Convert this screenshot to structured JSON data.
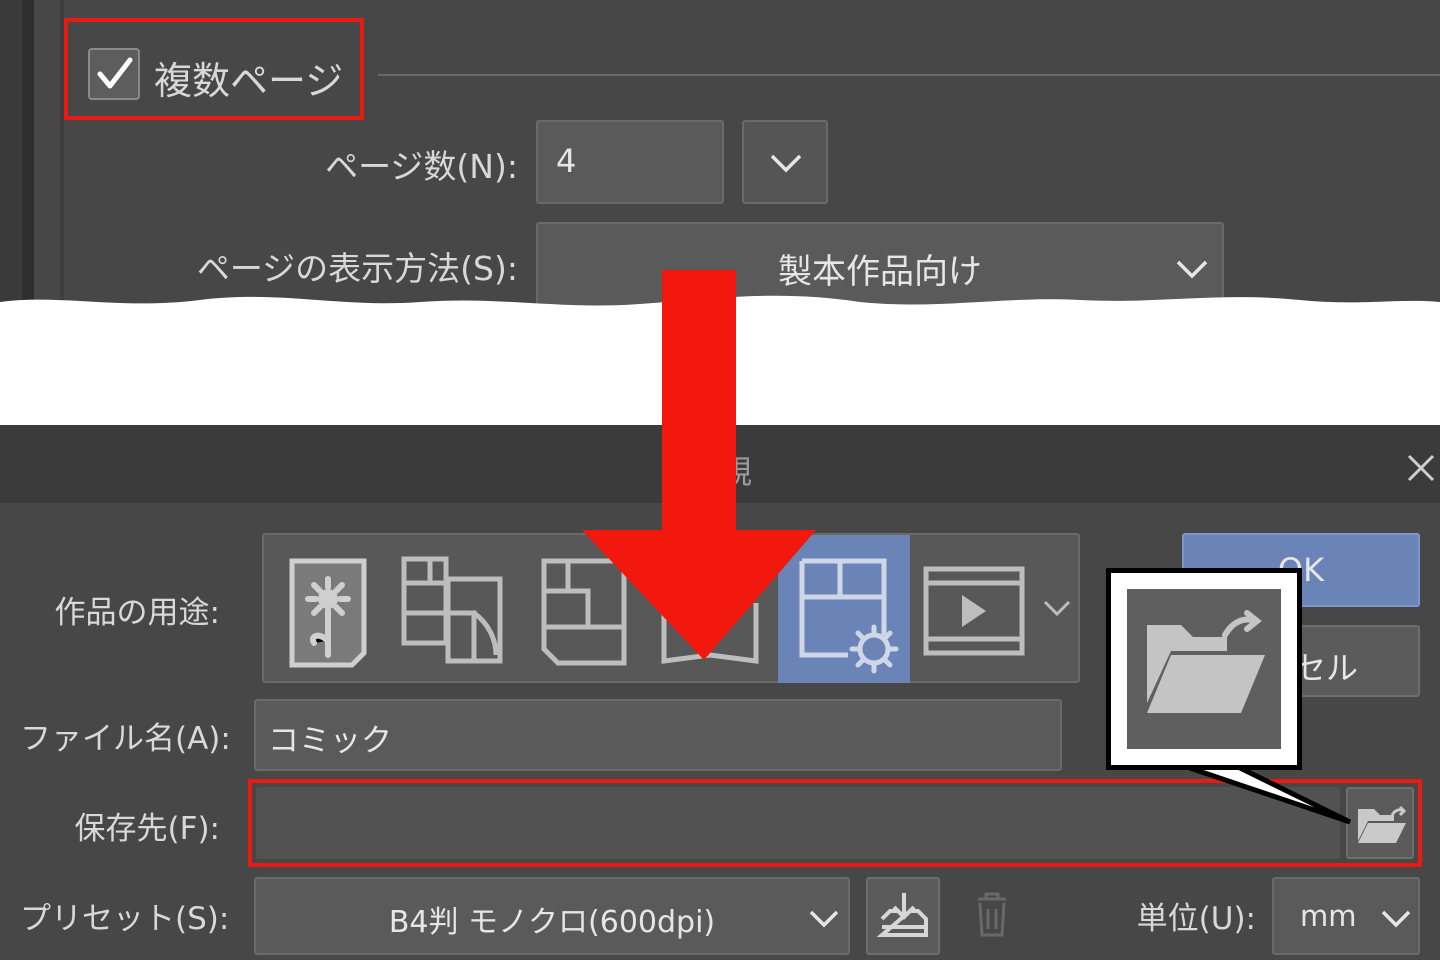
{
  "top": {
    "multi_page_label": "複数ページ",
    "multi_page_checked": true,
    "page_count_label": "ページ数(N):",
    "page_count_value": "4",
    "page_display_label": "ページの表示方法(S):",
    "page_display_value": "製本作品向け"
  },
  "dialog": {
    "title_fragment": "規",
    "usage_label": "作品の用途:",
    "usage_icons": [
      "illustration-icon",
      "comic-icon",
      "print-comic-icon",
      "book-icon",
      "custom-settings-icon",
      "animation-icon"
    ],
    "usage_selected_index": 4,
    "file_name_label": "ファイル名(A):",
    "file_name_value": "コミック",
    "save_to_label": "保存先(F):",
    "save_to_value": "",
    "preset_label": "プリセット(S):",
    "preset_value": "B4判 モノクロ(600dpi)",
    "unit_label": "単位(U):",
    "unit_value": "mm",
    "ok_label": "OK",
    "cancel_fragment": "セル"
  },
  "colors": {
    "highlight": "#e81a12",
    "selected_blue": "#6a84b8",
    "panel_bg": "#474747"
  }
}
